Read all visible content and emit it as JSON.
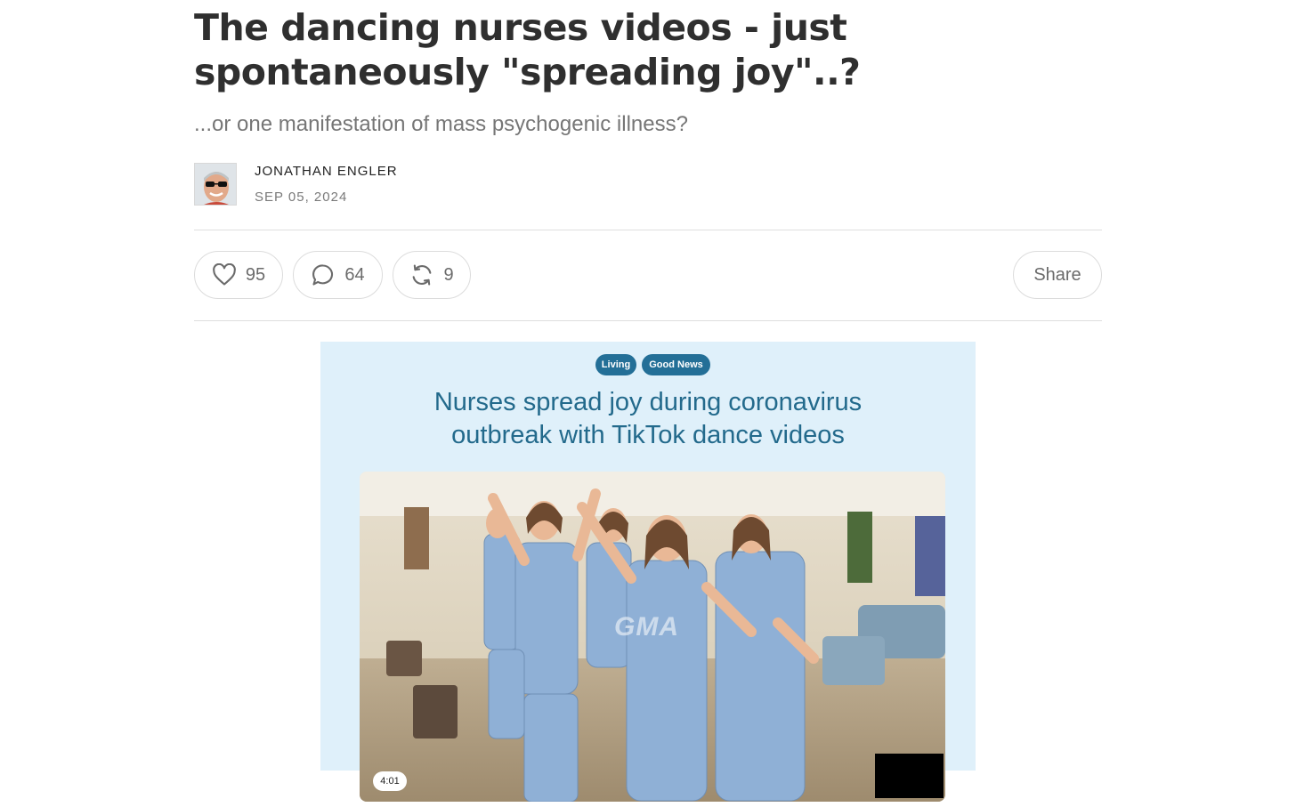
{
  "post": {
    "title": "The dancing nurses videos - just spontaneously \"spreading joy\"..?",
    "subtitle": "...or one manifestation of mass psychogenic illness?",
    "author": "JONATHAN ENGLER",
    "date": "SEP 05, 2024"
  },
  "actions": {
    "likes": "95",
    "comments": "64",
    "restacks": "9",
    "share_label": "Share"
  },
  "icons": {
    "like": "heart-icon",
    "comment": "comment-bubble-icon",
    "restack": "restack-icon"
  },
  "embed": {
    "tags": [
      "Living",
      "Good News"
    ],
    "headline_line1": "Nurses spread joy during coronavirus",
    "headline_line2": "outbreak with TikTok dance videos",
    "watermark": "GMA",
    "duration": "4:01",
    "colors": {
      "card_background": "#dff0fa",
      "tag_background": "#236f97",
      "headline": "#236a8c"
    }
  }
}
